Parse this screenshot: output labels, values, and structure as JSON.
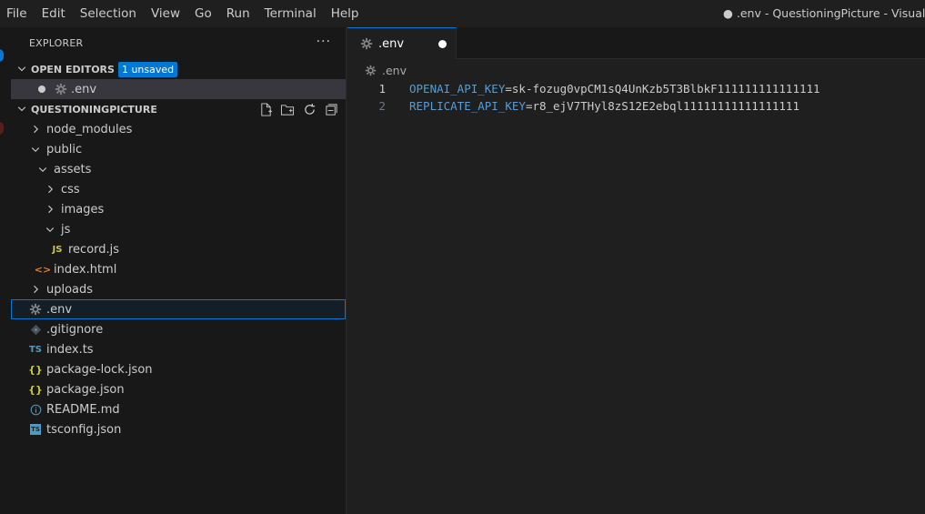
{
  "menu": [
    "File",
    "Edit",
    "Selection",
    "View",
    "Go",
    "Run",
    "Terminal",
    "Help"
  ],
  "window_title": "● .env - QuestioningPicture - Visual Studio Code",
  "sidebar": {
    "title": "EXPLORER",
    "more": "···",
    "open_editors": {
      "label": "OPEN EDITORS",
      "badge": "1 unsaved",
      "items": [
        {
          "name": ".env",
          "dirty": true
        }
      ]
    },
    "project": {
      "label": "QUESTIONINGPICTURE",
      "tree": [
        {
          "name": "node_modules",
          "type": "folder",
          "expanded": false,
          "depth": 0
        },
        {
          "name": "public",
          "type": "folder",
          "expanded": true,
          "depth": 0
        },
        {
          "name": "assets",
          "type": "folder",
          "expanded": true,
          "depth": 1
        },
        {
          "name": "css",
          "type": "folder",
          "expanded": false,
          "depth": 2
        },
        {
          "name": "images",
          "type": "folder",
          "expanded": false,
          "depth": 2
        },
        {
          "name": "js",
          "type": "folder",
          "expanded": true,
          "depth": 2
        },
        {
          "name": "record.js",
          "type": "js",
          "depth": 3
        },
        {
          "name": "index.html",
          "type": "html",
          "depth": 1
        },
        {
          "name": "uploads",
          "type": "folder",
          "expanded": false,
          "depth": 0
        },
        {
          "name": ".env",
          "type": "env",
          "depth": 0,
          "selected": true
        },
        {
          "name": ".gitignore",
          "type": "git",
          "depth": 0
        },
        {
          "name": "index.ts",
          "type": "ts",
          "depth": 0
        },
        {
          "name": "package-lock.json",
          "type": "json",
          "depth": 0
        },
        {
          "name": "package.json",
          "type": "json",
          "depth": 0
        },
        {
          "name": "README.md",
          "type": "info",
          "depth": 0
        },
        {
          "name": "tsconfig.json",
          "type": "tsconfig",
          "depth": 0
        }
      ]
    }
  },
  "editor": {
    "tab_label": ".env",
    "breadcrumb": ".env",
    "lines": [
      {
        "number": "1",
        "key": "OPENAI_API_KEY",
        "value": "sk-fozug0vpCM1sQ4UnKzb5T3BlbkF111111111111111"
      },
      {
        "number": "2",
        "key": "REPLICATE_API_KEY",
        "value": "r8_ejV7THyl8zS12E2ebql11111111111111111"
      }
    ]
  },
  "colors": {
    "accent": "#0078d4",
    "js": "#cbcb41",
    "ts": "#519aba",
    "json": "#cbcb41",
    "html": "#e37933",
    "info": "#519aba",
    "gear": "#8a8a8a"
  }
}
